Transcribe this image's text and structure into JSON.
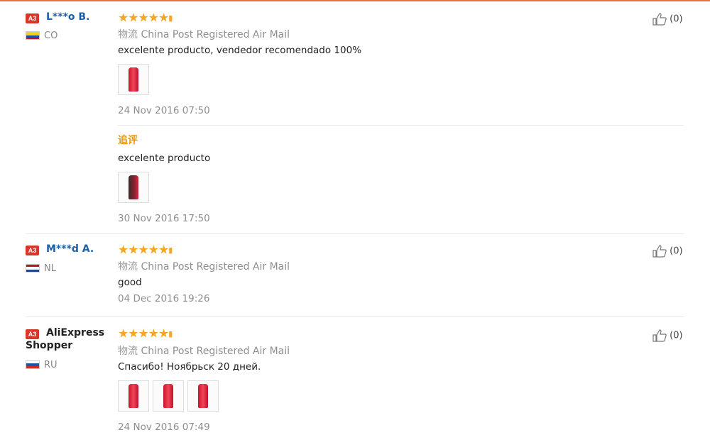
{
  "reviews": [
    {
      "badge": "A3",
      "user": "L***o B.",
      "country": "CO",
      "shipping_cn": "物流",
      "shipping": "China Post Registered Air Mail",
      "text": "excelente producto, vendedor recomendado 100%",
      "date": "24 Nov 2016 07:50",
      "likes": "(0)",
      "additional": {
        "label": "追评",
        "text": "excelente producto",
        "date": "30 Nov 2016 17:50"
      }
    },
    {
      "badge": "A3",
      "user": "M***d A.",
      "country": "NL",
      "shipping_cn": "物流",
      "shipping": "China Post Registered Air Mail",
      "text": "good",
      "date": "04 Dec 2016 19:26",
      "likes": "(0)"
    },
    {
      "badge": "A3",
      "user": "AliExpress Shopper",
      "country": "RU",
      "shipping_cn": "物流",
      "shipping": "China Post Registered Air Mail",
      "text": "Спасибо! Ноябрьск 20 дней.",
      "date": "24 Nov 2016 07:49",
      "likes": "(0)"
    }
  ],
  "rating_stars": 5,
  "icons": {
    "star": "star-icon",
    "thumbs_up": "thumbs-up-icon",
    "flag_co": "flag-co-icon",
    "flag_nl": "flag-nl-icon",
    "flag_ru": "flag-ru-icon"
  },
  "colors": {
    "accent": "#e8733f",
    "star": "#f5a623",
    "username": "#1d5fa8",
    "badge": "#d9362a",
    "additional_label": "#e8960c"
  }
}
